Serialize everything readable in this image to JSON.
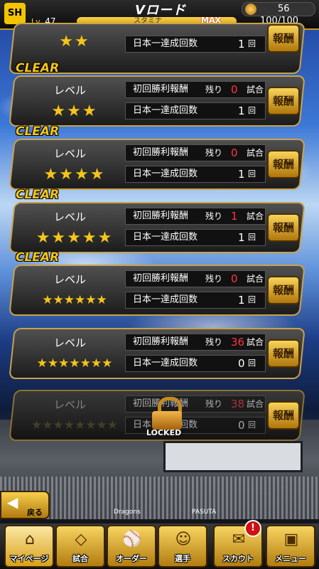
{
  "header": {
    "logo": "SH",
    "level_label": "Lv.",
    "level_value": "47",
    "title": "Vロード",
    "stamina_label": "スタミナ",
    "stamina_max": "MAX",
    "stamina_value": "100/100",
    "coins": "56"
  },
  "cards": [
    {
      "clear": "",
      "level_label": "",
      "stars": "★★",
      "first_win_label": "",
      "remaining_label": "",
      "remaining": "",
      "remaining_unit": "",
      "champ_label": "日本一達成回数",
      "champ_count": "1",
      "champ_unit": "回",
      "reward_button": "報酬"
    },
    {
      "clear": "CLEAR",
      "level_label": "レベル",
      "stars": "★★★",
      "first_win_label": "初回勝利報酬",
      "remaining_label": "残り",
      "remaining": "0",
      "remaining_unit": "試合",
      "champ_label": "日本一達成回数",
      "champ_count": "1",
      "champ_unit": "回",
      "reward_button": "報酬"
    },
    {
      "clear": "CLEAR",
      "level_label": "レベル",
      "stars": "★★★★",
      "first_win_label": "初回勝利報酬",
      "remaining_label": "残り",
      "remaining": "0",
      "remaining_unit": "試合",
      "champ_label": "日本一達成回数",
      "champ_count": "1",
      "champ_unit": "回",
      "reward_button": "報酬"
    },
    {
      "clear": "CLEAR",
      "level_label": "レベル",
      "stars": "★★★★★",
      "first_win_label": "初回勝利報酬",
      "remaining_label": "残り",
      "remaining": "1",
      "remaining_unit": "試合",
      "champ_label": "日本一達成回数",
      "champ_count": "1",
      "champ_unit": "回",
      "reward_button": "報酬"
    },
    {
      "clear": "CLEAR",
      "level_label": "レベル",
      "stars": "★★★★★★",
      "first_win_label": "初回勝利報酬",
      "remaining_label": "残り",
      "remaining": "0",
      "remaining_unit": "試合",
      "champ_label": "日本一達成回数",
      "champ_count": "1",
      "champ_unit": "回",
      "reward_button": "報酬"
    },
    {
      "clear": "",
      "level_label": "レベル",
      "stars": "★★★★★★★",
      "first_win_label": "初回勝利報酬",
      "remaining_label": "残り",
      "remaining": "36",
      "remaining_unit": "試合",
      "champ_label": "日本一達成回数",
      "champ_count": "0",
      "champ_unit": "回",
      "reward_button": "報酬"
    },
    {
      "clear": "",
      "level_label": "レベル",
      "stars": "★★★★★★★★",
      "first_win_label": "初回勝利報酬",
      "remaining_label": "残り",
      "remaining": "38",
      "remaining_unit": "試合",
      "champ_label": "日本一達成回数",
      "champ_count": "0",
      "champ_unit": "回",
      "reward_button": "報酬",
      "locked_label": "LOCKED"
    }
  ],
  "stadium": {
    "ad1": "Dragons",
    "ad2": "PASUTA"
  },
  "back_button": "戻る",
  "nav": [
    {
      "label": "マイページ",
      "icon": "home-icon"
    },
    {
      "label": "試合",
      "icon": "baseball-diamond-icon"
    },
    {
      "label": "オーダー",
      "icon": "order-icon"
    },
    {
      "label": "選手",
      "icon": "player-icon"
    },
    {
      "label": "スカウト",
      "icon": "scout-icon"
    },
    {
      "label": "メニュー",
      "icon": "menu-icon"
    }
  ],
  "scout_badge": "!"
}
